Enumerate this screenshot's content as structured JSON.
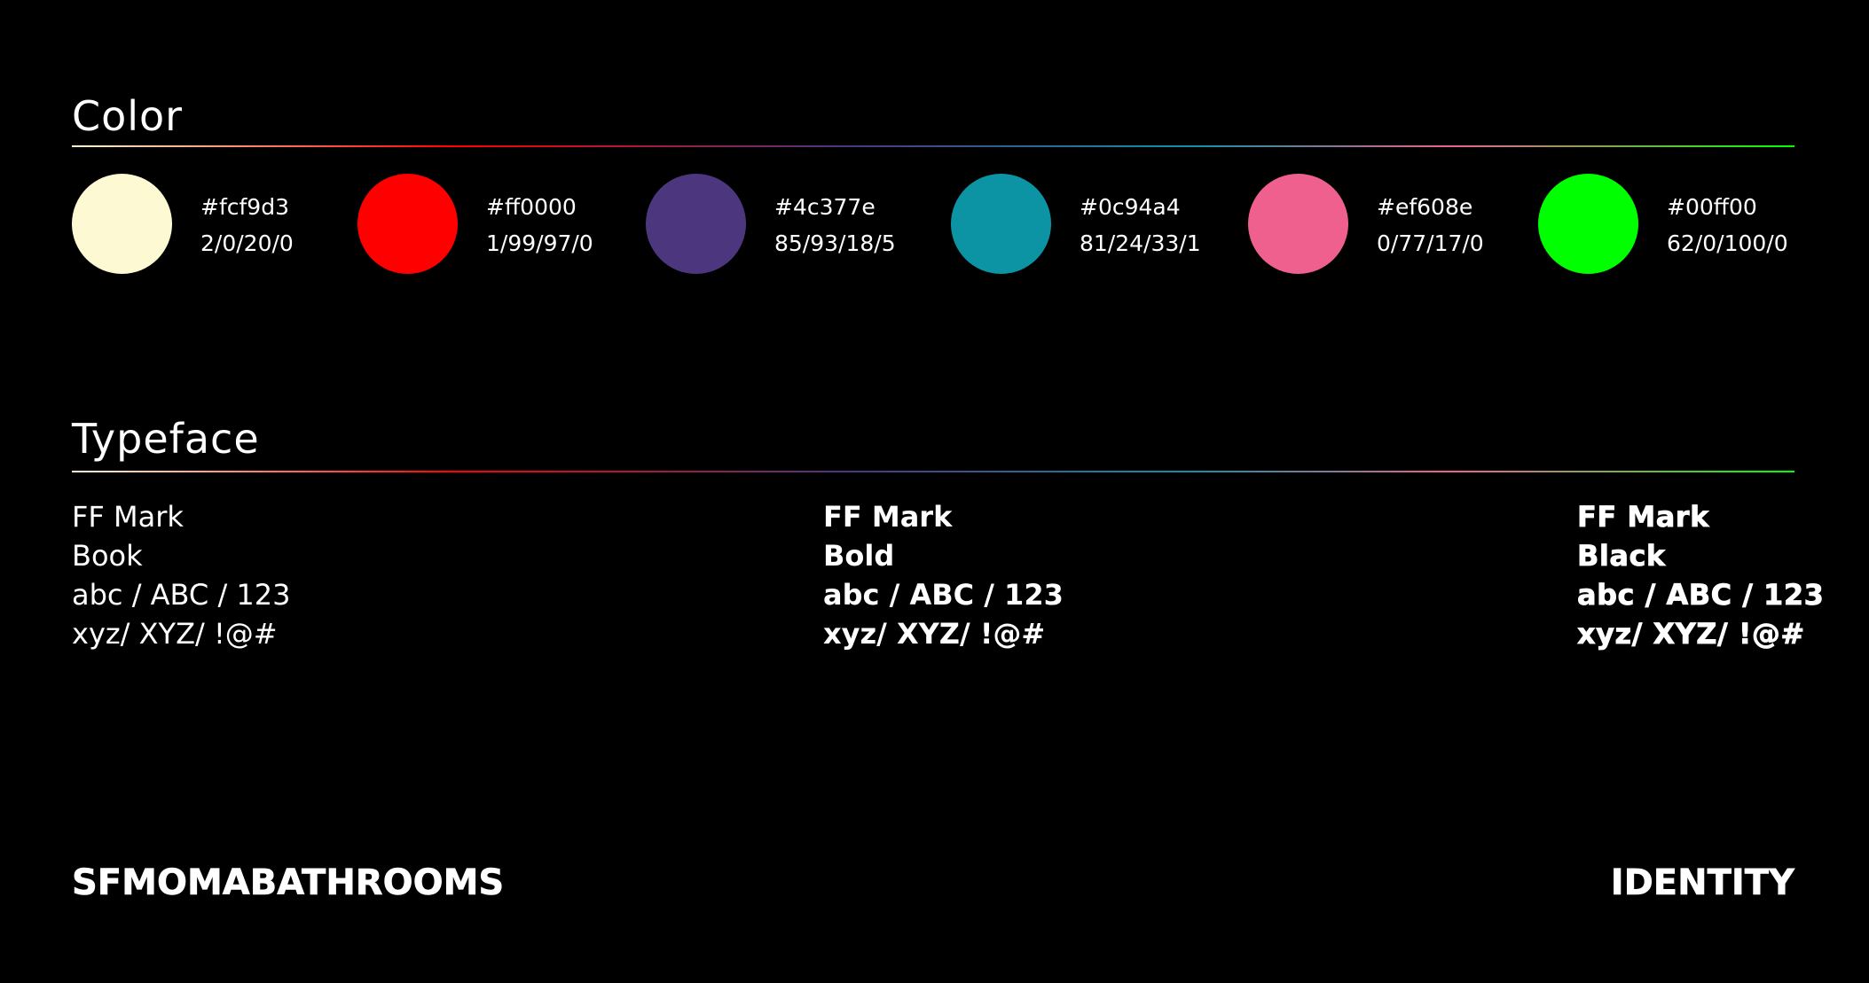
{
  "color_section": {
    "title": "Color",
    "swatches": [
      {
        "hex": "#fcf9d3",
        "cmyk": "2/0/20/0",
        "color": "#fcf9d3"
      },
      {
        "hex": "#ff0000",
        "cmyk": "1/99/97/0",
        "color": "#ff0000"
      },
      {
        "hex": "#4c377e",
        "cmyk": "85/93/18/5",
        "color": "#4c377e"
      },
      {
        "hex": "#0c94a4",
        "cmyk": "81/24/33/1",
        "color": "#0c94a4"
      },
      {
        "hex": "#ef608e",
        "cmyk": "0/77/17/0",
        "color": "#ef608e"
      },
      {
        "hex": "#00ff00",
        "cmyk": "62/0/100/0",
        "color": "#00ff00"
      }
    ]
  },
  "typeface_section": {
    "title": "Typeface",
    "weights": [
      {
        "family": "FF Mark",
        "weight": "Book",
        "sample1": "abc / ABC / 123",
        "sample2": "xyz/ XYZ/ !@#"
      },
      {
        "family": "FF Mark",
        "weight": "Bold",
        "sample1": "abc / ABC / 123",
        "sample2": "xyz/ XYZ/ !@#"
      },
      {
        "family": "FF Mark",
        "weight": "Black",
        "sample1": "abc / ABC / 123",
        "sample2": "xyz/ XYZ/ !@#"
      }
    ]
  },
  "footer": {
    "left": "SFMOMABATHROOMS",
    "right": "IDENTITY"
  }
}
